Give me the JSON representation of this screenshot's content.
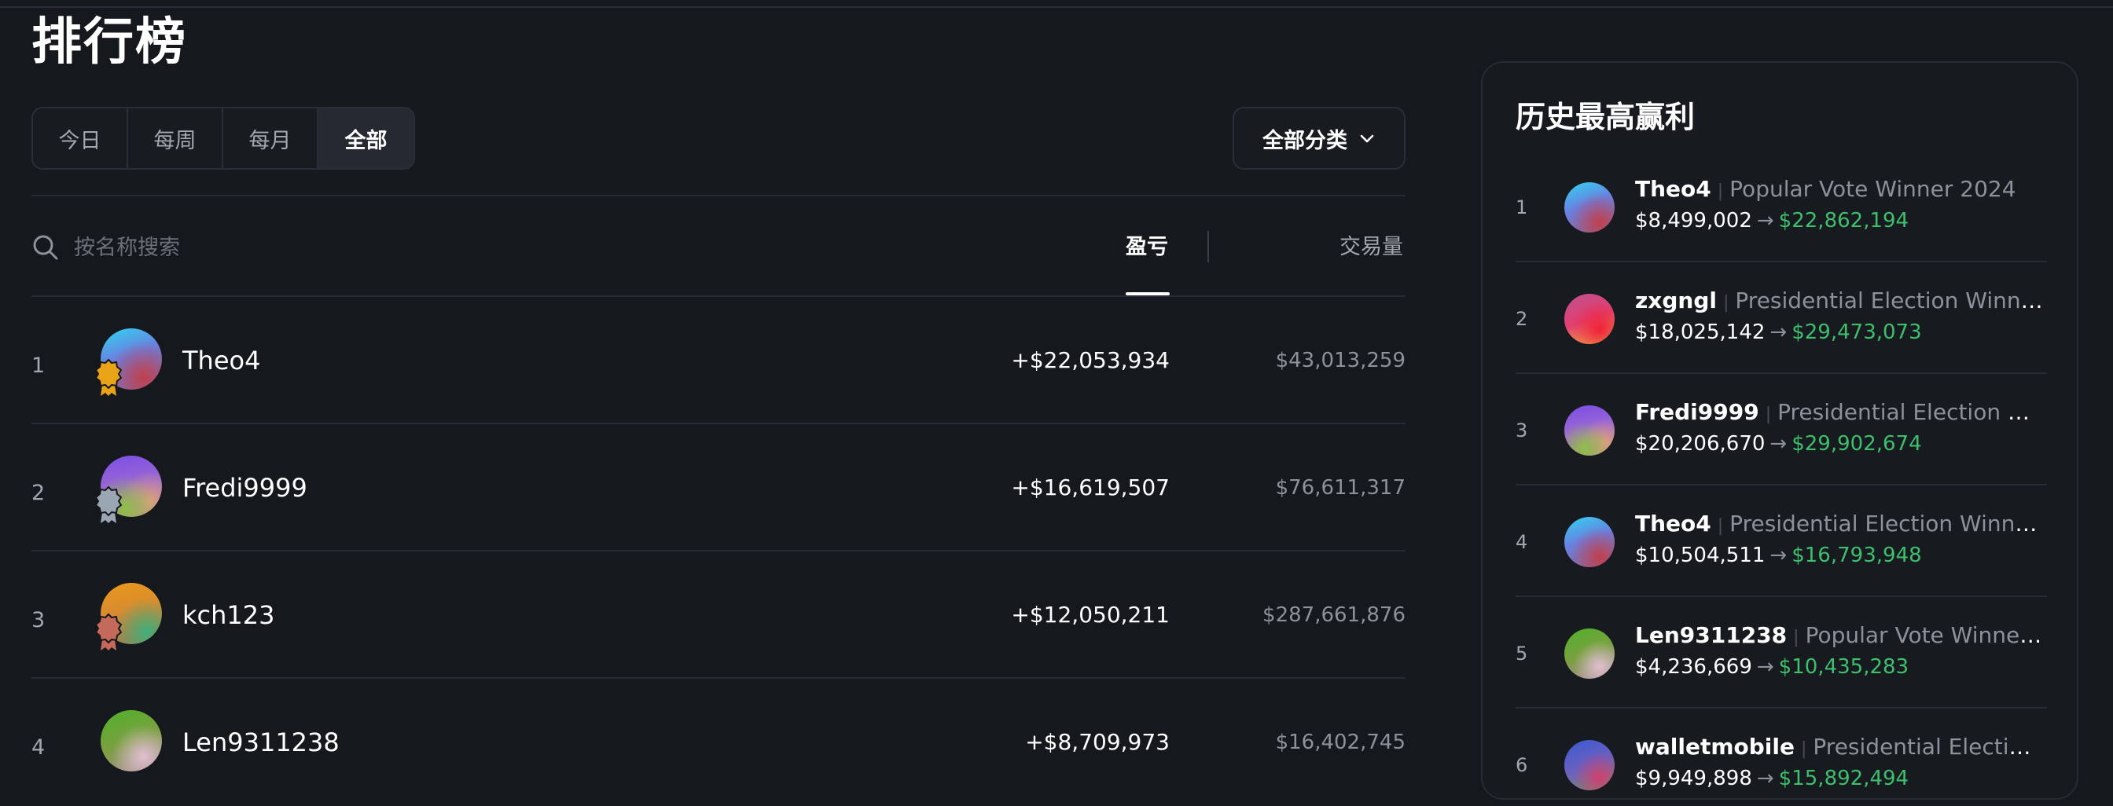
{
  "title": "排行榜",
  "period_tabs": [
    {
      "label": "今日",
      "active": false
    },
    {
      "label": "每周",
      "active": false
    },
    {
      "label": "每月",
      "active": false
    },
    {
      "label": "全部",
      "active": true
    }
  ],
  "category_select": {
    "label": "全部分类",
    "icon": "chevron-down-icon"
  },
  "search": {
    "placeholder": "按名称搜索",
    "value": ""
  },
  "sort_tabs": {
    "pnl": "盈亏",
    "volume": "交易量",
    "active": "pnl"
  },
  "leaderboard": [
    {
      "rank": "1",
      "name": "Theo4",
      "pnl": "+$22,053,934",
      "volume": "$43,013,259",
      "medal": "gold"
    },
    {
      "rank": "2",
      "name": "Fredi9999",
      "pnl": "+$16,619,507",
      "volume": "$76,611,317",
      "medal": "silver"
    },
    {
      "rank": "3",
      "name": "kch123",
      "pnl": "+$12,050,211",
      "volume": "$287,661,876",
      "medal": "bronze"
    },
    {
      "rank": "4",
      "name": "Len9311238",
      "pnl": "+$8,709,973",
      "volume": "$16,402,745",
      "medal": ""
    }
  ],
  "biggest_wins": {
    "title": "历史最高赢利",
    "items": [
      {
        "rank": "1",
        "user": "Theo4",
        "market": "Popular Vote Winner 2024",
        "from": "$8,499,002",
        "to": "$22,862,194"
      },
      {
        "rank": "2",
        "user": "zxgngl",
        "market": "Presidential Election Winne...",
        "from": "$18,025,142",
        "to": "$29,473,073"
      },
      {
        "rank": "3",
        "user": "Fredi9999",
        "market": "Presidential Election Wi...",
        "from": "$20,206,670",
        "to": "$29,902,674"
      },
      {
        "rank": "4",
        "user": "Theo4",
        "market": "Presidential Election Winne...",
        "from": "$10,504,511",
        "to": "$16,793,948"
      },
      {
        "rank": "5",
        "user": "Len9311238",
        "market": "Popular Vote Winner ...",
        "from": "$4,236,669",
        "to": "$10,435,283"
      },
      {
        "rank": "6",
        "user": "walletmobile",
        "market": "Presidential Election ...",
        "from": "$9,949,898",
        "to": "$15,892,494"
      }
    ]
  },
  "colors": {
    "profit_green": "#3dbf6d",
    "gold": "#e8a317",
    "silver": "#9aa6b2",
    "bronze": "#c46a5a",
    "background": "#15181c"
  },
  "arrow_glyph": "→"
}
